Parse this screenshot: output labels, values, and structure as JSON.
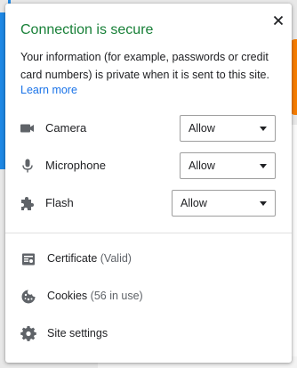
{
  "popup": {
    "title": "Connection is secure",
    "description": "Your information (for example, passwords or credit card numbers) is private when it is sent to this site.",
    "learn_more": "Learn more"
  },
  "permissions": [
    {
      "label": "Camera",
      "icon": "camera-icon",
      "value": "Allow"
    },
    {
      "label": "Microphone",
      "icon": "microphone-icon",
      "value": "Allow"
    },
    {
      "label": "Flash",
      "icon": "puzzle-icon",
      "value": "Allow"
    }
  ],
  "links": {
    "certificate": {
      "label": "Certificate",
      "detail": "(Valid)",
      "icon": "certificate-icon"
    },
    "cookies": {
      "label": "Cookies",
      "detail": "(56 in use)",
      "icon": "cookie-icon"
    },
    "site_settings": {
      "label": "Site settings",
      "icon": "gear-icon"
    }
  },
  "colors": {
    "title": "#188038",
    "link": "#1a73e8",
    "text": "#202124"
  }
}
